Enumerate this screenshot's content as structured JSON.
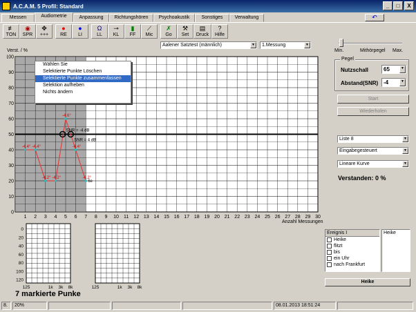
{
  "window": {
    "title": "A.C.A.M. 5  Profil: Standard",
    "buttons": [
      "_",
      "□",
      "X"
    ]
  },
  "tabs": [
    "Messen",
    "Audiometrie",
    "Anpassung",
    "Richtungshören",
    "Psychoakustik",
    "Sonstiges",
    "Verwaltung"
  ],
  "active_tab": "Audiometrie",
  "toolbar": [
    {
      "label": "TON",
      "icon": "tone-icon"
    },
    {
      "label": "SPR",
      "icon": "lips-icon"
    },
    {
      "label": "+++",
      "icon": "plus-icon"
    },
    {
      "label": "RE",
      "icon": "right-ear-icon"
    },
    {
      "label": "LI",
      "icon": "left-ear-icon"
    },
    {
      "label": "LL",
      "icon": "headphones-icon"
    },
    {
      "label": "KL",
      "icon": "bone-conductor-icon"
    },
    {
      "label": "FF",
      "icon": "speaker-icon"
    },
    {
      "label": "Mic",
      "icon": "microphone-icon"
    },
    {
      "label": "Go",
      "icon": "runner-icon"
    },
    {
      "label": "Set",
      "icon": "tools-icon"
    },
    {
      "label": "Druck",
      "icon": "printer-icon"
    },
    {
      "label": "Hilfe",
      "icon": "help-icon"
    }
  ],
  "test_select": "Aalener Satztest (männlich)",
  "measure_select": "1.Messung",
  "slider": {
    "min_label": "Min.",
    "mid_label": "Mithörpegel",
    "max_label": "Max."
  },
  "pegel": {
    "title": "Pegel",
    "nutzschall_label": "Nutzschall",
    "nutzschall_value": "65",
    "abstand_label": "Abstand(SNR)",
    "abstand_value": "-4"
  },
  "buttons": {
    "start": "Start",
    "wiederholen": "Wiederholen"
  },
  "list_select": "Liste 8",
  "mode_select": "Eingabegesteuert",
  "curve_select": "Lineare Kurve",
  "verstanden": "Verstanden: 0 %",
  "context_menu": [
    "Wählen Sie",
    "Selektierte Punkte Löschen",
    "Selektierte Punkte zusammenfassen",
    "Selektion aufheben",
    "Nichts ändern"
  ],
  "context_menu_selected": 2,
  "chart_data": {
    "type": "line",
    "ylabel": "Verst. / %",
    "xlabel": "Anzahl Messungen",
    "xlim": [
      0,
      30
    ],
    "ylim": [
      0,
      100
    ],
    "reference_line_y": 50,
    "selection_range_x": [
      0,
      7
    ],
    "points": [
      {
        "x": 1,
        "y": 40,
        "label": "-4.4°"
      },
      {
        "x": 2,
        "y": 40,
        "label": "-4.4°"
      },
      {
        "x": 3,
        "y": 20,
        "label": "-4.2°"
      },
      {
        "x": 4,
        "y": 20,
        "label": "-4.2°"
      },
      {
        "x": 5,
        "y": 60,
        "label": "-4.6°"
      },
      {
        "x": 6,
        "y": 40,
        "label": "-4.4°"
      },
      {
        "x": 7,
        "y": 20,
        "label": "-4.2°"
      }
    ],
    "markers": [
      {
        "x": 4.7,
        "y": 50,
        "label": "SNR = -4 dB"
      },
      {
        "x": 5.5,
        "y": 50,
        "label": "SNR = 4 dB"
      }
    ],
    "end_label": "6e"
  },
  "mini_audiogram": {
    "y_ticks": [
      "0",
      "20",
      "40",
      "60",
      "80",
      "100",
      "120"
    ],
    "x_ticks": [
      "125",
      "1k",
      "3k",
      "8k"
    ]
  },
  "event_panel": {
    "header": "Ereignis I",
    "items": [
      "Heike",
      "flitzt",
      "bis",
      "ein Uhr",
      "nach Frankfurt"
    ],
    "side_label": "Heike",
    "bottom_label": "Heike"
  },
  "marked_points": "7 markierte Punke",
  "status": {
    "left": "8.",
    "percent": "20%",
    "datetime": "08.01.2013 18:51:24"
  }
}
